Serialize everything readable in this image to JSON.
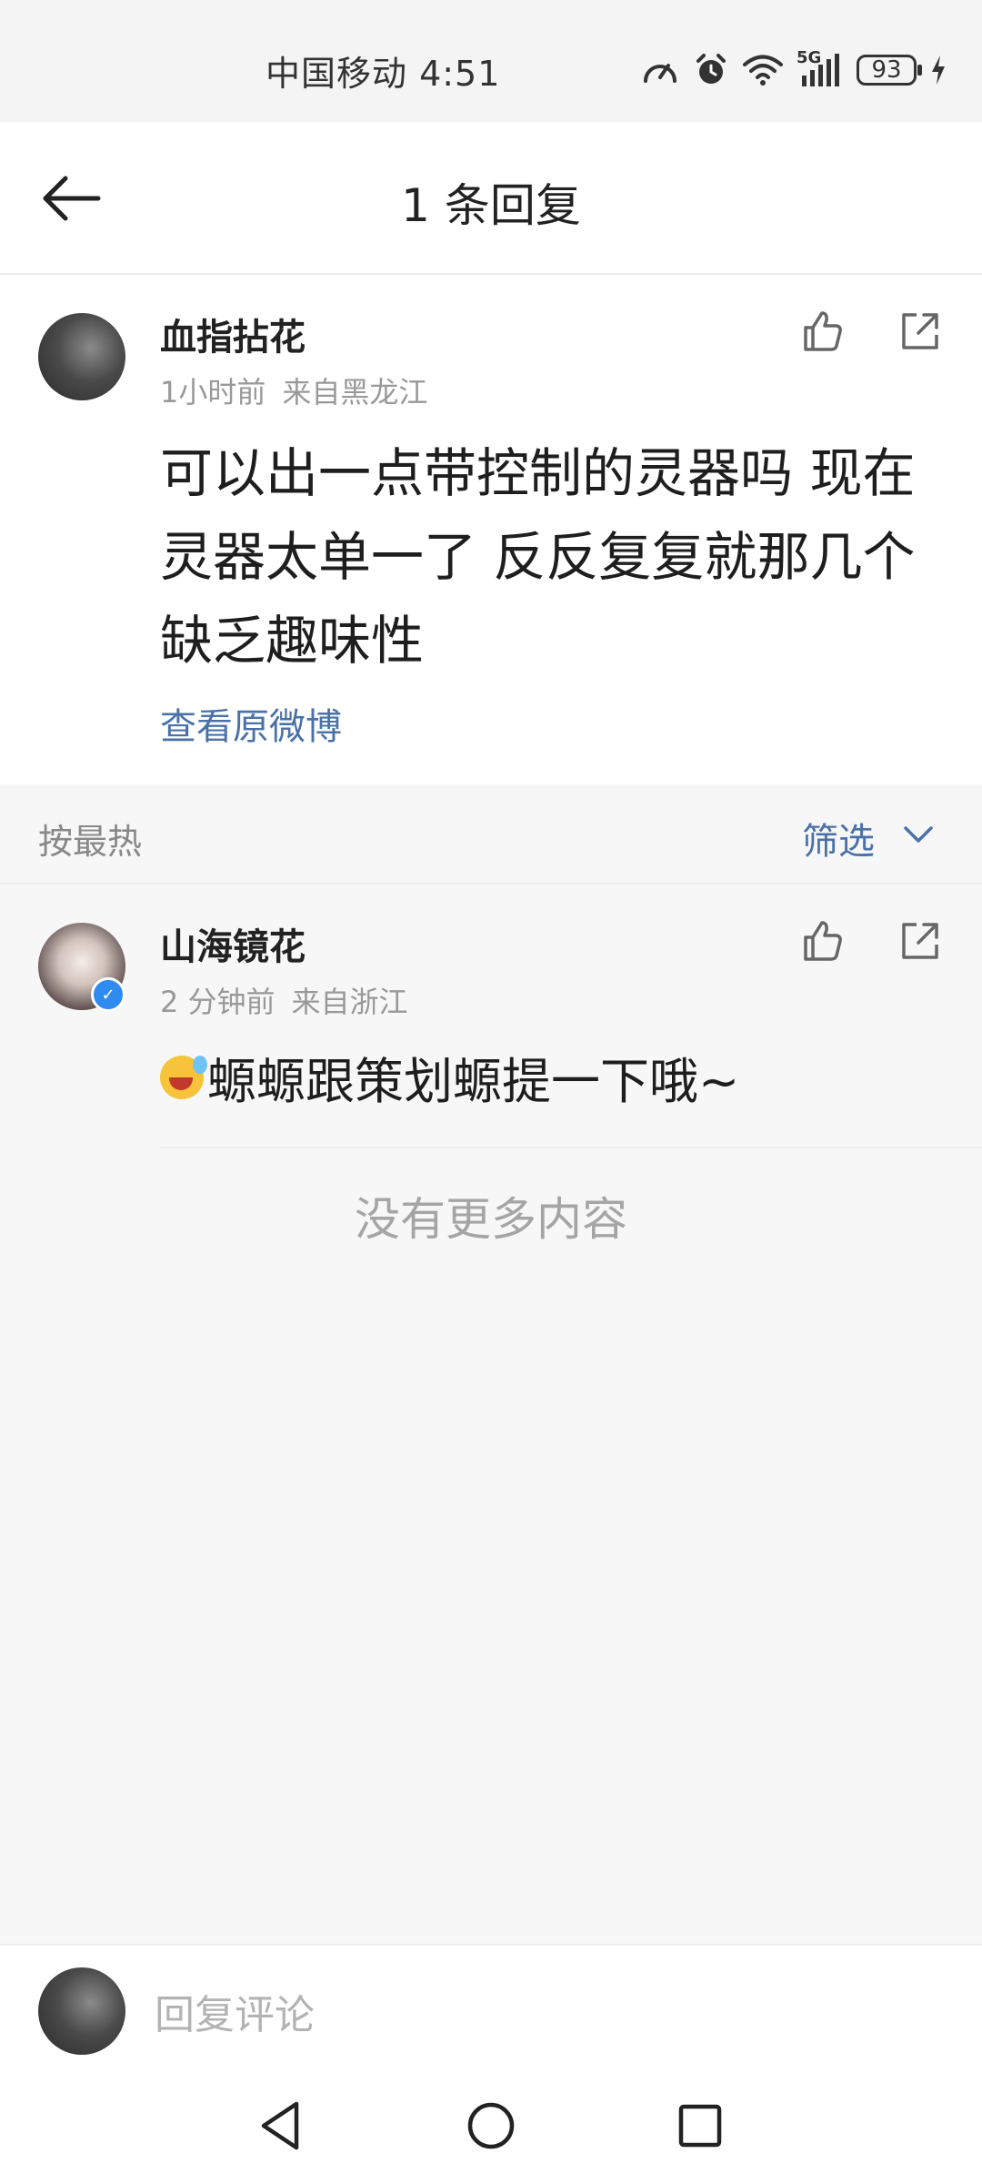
{
  "status_bar": {
    "carrier_time": "中国移动 4:51",
    "network": "5G",
    "battery": "93"
  },
  "header": {
    "title": "1 条回复"
  },
  "original_comment": {
    "username": "血指拈花",
    "time": "1小时前",
    "location": "来自黑龙江",
    "text": "可以出一点带控制的灵器吗 现在灵器太单一了 反反复复就那几个 缺乏趣味性",
    "view_original": "查看原微博"
  },
  "sort": {
    "label": "按最热",
    "filter": "筛选"
  },
  "replies": [
    {
      "username": "山海镜花",
      "time": "2 分钟前",
      "location": "来自浙江",
      "text": "螈螈跟策划螈提一下哦~"
    }
  ],
  "no_more": "没有更多内容",
  "reply_box": {
    "placeholder": "回复评论"
  },
  "icons": {
    "like": "thumbs-up-icon",
    "share": "share-icon",
    "back": "back-arrow-icon"
  },
  "colors": {
    "link": "#4a72a8",
    "verified": "#2f8bf0"
  }
}
